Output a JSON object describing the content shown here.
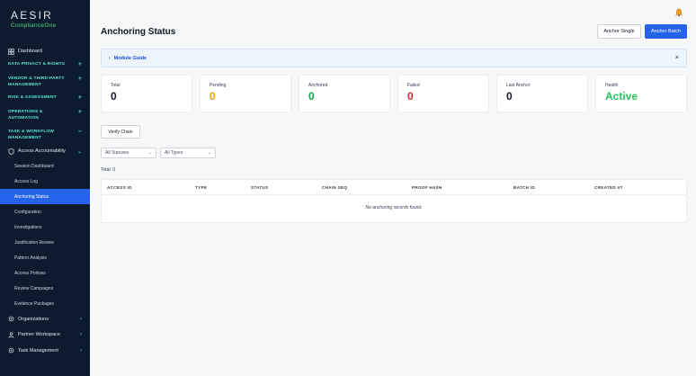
{
  "brand": {
    "name": "AESIR",
    "sub": "ComplianceOne"
  },
  "sidebar": {
    "dashboard": "Dashboard",
    "sections": [
      {
        "label": "DATA PRIVACY & RIGHTS",
        "sign": "+"
      },
      {
        "label": "VENDOR & THIRD-PARTY MANAGEMENT",
        "sign": "+"
      },
      {
        "label": "RISK & ASSESSMENT",
        "sign": "+"
      },
      {
        "label": "OPERATIONS & AUTOMATION",
        "sign": "+"
      },
      {
        "label": "TASK & WORKFLOW MANAGEMENT",
        "sign": "−"
      }
    ],
    "group": "Access Accountability",
    "subitems": [
      "Session Dashboard",
      "Access Log",
      "Anchoring Status",
      "Configuration",
      "Investigations",
      "Justification Review",
      "Pattern Analysis",
      "Access Policies",
      "Review Campaigns",
      "Evidence Packages"
    ],
    "bottom": [
      "Organizations",
      "Partner Workspace",
      "Task Management"
    ]
  },
  "header": {
    "title": "Anchoring Status",
    "anchor_single": "Anchor Single",
    "anchor_batch": "Anchor Batch"
  },
  "guide": {
    "label": "Module Guide",
    "close": "×"
  },
  "stats": [
    {
      "label": "Total",
      "value": "0"
    },
    {
      "label": "Pending",
      "value": "0"
    },
    {
      "label": "Anchored",
      "value": "0"
    },
    {
      "label": "Failed",
      "value": "0"
    },
    {
      "label": "Last Anchor",
      "value": "0"
    },
    {
      "label": "Health",
      "value": "Active"
    }
  ],
  "verify": "Verify Chain",
  "filters": {
    "status": "All Statuses",
    "type": "All Types"
  },
  "total_count": "Total: 0",
  "table": {
    "columns": [
      "ACCESS ID",
      "TYPE",
      "STATUS",
      "CHAIN SEQ",
      "PROOF HASH",
      "BATCH ID",
      "CREATED AT"
    ],
    "empty": "No anchoring records found."
  },
  "colors": {
    "sidebar_bg": "#0c1b2e",
    "accent": "#2563eb",
    "pending": "#f59e0b",
    "anchored": "#16a34a",
    "failed": "#dc2626",
    "health": "#22c55e"
  }
}
